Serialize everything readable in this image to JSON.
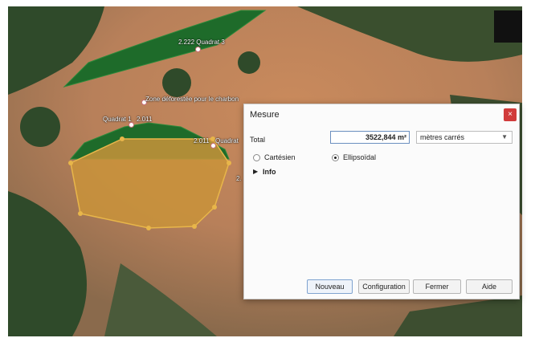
{
  "map": {
    "labels": {
      "quadrat3": "2.222  Quadrat 3",
      "zone": "Zone déforestée pour le charbon",
      "quadrat1": "Quadrat 1",
      "val_2011_left": "2.011",
      "val_2011_right": "2.011",
      "quadrat_right": "Quadrat",
      "partial": "2."
    }
  },
  "dialog": {
    "title": "Mesure",
    "close_glyph": "×",
    "total_label": "Total",
    "total_value": "3522,844 m²",
    "units_selected": "mètres carrés",
    "radio_cartesian": "Cartésien",
    "radio_ellipsoidal": "Ellipsoïdal",
    "ellipsoidal_selected": true,
    "info_label": "Info",
    "buttons": {
      "new": "Nouveau",
      "config": "Configuration",
      "close": "Fermer",
      "help": "Aide"
    }
  },
  "colors": {
    "polygon_fill": "#c9933a",
    "polygon_stroke": "#e8b64a",
    "quadrat_fill": "#1e6b2a",
    "close_button": "#d13b3b"
  }
}
